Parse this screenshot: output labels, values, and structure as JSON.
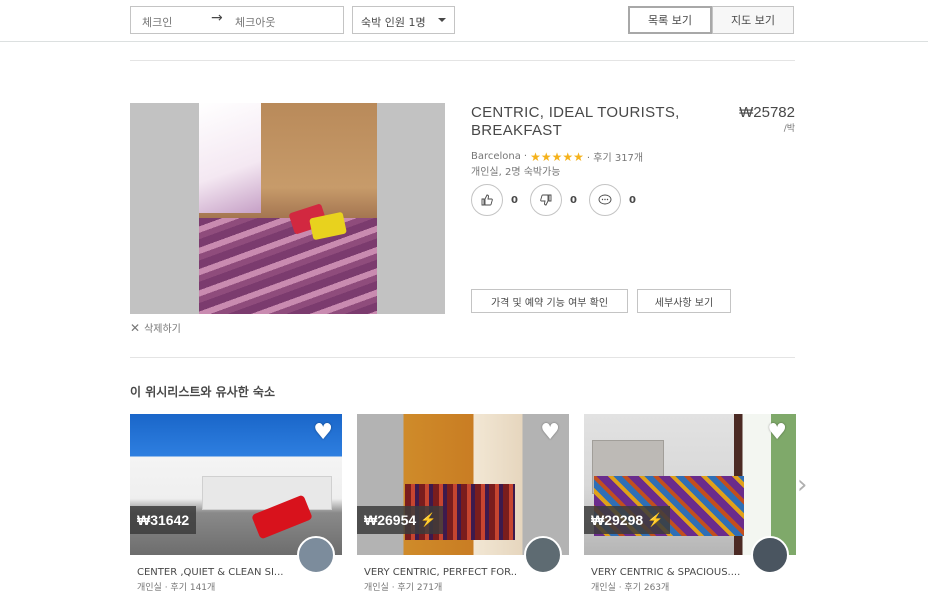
{
  "search": {
    "checkin_placeholder": "체크인",
    "arrow": "→",
    "checkout_placeholder": "체크아웃",
    "guests_label": "숙박 인원 1명"
  },
  "view_toggle": {
    "list_label": "목록 보기",
    "map_label": "지도 보기",
    "active": "list"
  },
  "listing": {
    "title_line1": "CENTRIC, IDEAL TOURISTS,",
    "title_line2": "BREAKFAST",
    "price": "₩25782",
    "per": "/박",
    "city": "Barcelona",
    "rating": 5,
    "reviews": "· 후기 317개",
    "room_info": "개인실, 2명 숙박가능",
    "reactions": [
      {
        "icon": "thumbs-up-icon",
        "glyph": "👍",
        "count": "0"
      },
      {
        "icon": "thumbs-down-icon",
        "glyph": "👎",
        "count": "0"
      },
      {
        "icon": "comment-icon",
        "glyph": "💬",
        "count": "0"
      }
    ],
    "check_button": "가격 및 예약 기능 여부 확인",
    "details_button": "세부사항 보기",
    "delete_label": "삭제하기"
  },
  "similar": {
    "title": "이 위시리스트와 유사한 숙소",
    "cards": [
      {
        "price": "₩31642",
        "instant": false,
        "name": "CENTER ,QUIET & CLEAN SI...",
        "sub": "개인실 · 후기 141개"
      },
      {
        "price": "₩26954",
        "instant": true,
        "name": "VERY CENTRIC, PERFECT FOR..",
        "sub": "개인실 · 후기 271개"
      },
      {
        "price": "₩29298",
        "instant": true,
        "name": "VERY CENTRIC & SPACIOUS....",
        "sub": "개인실 · 후기 263개"
      }
    ]
  },
  "colors": {
    "star": "#f5b21c",
    "instant_bolt": "#ffb400",
    "text": "#484848"
  }
}
